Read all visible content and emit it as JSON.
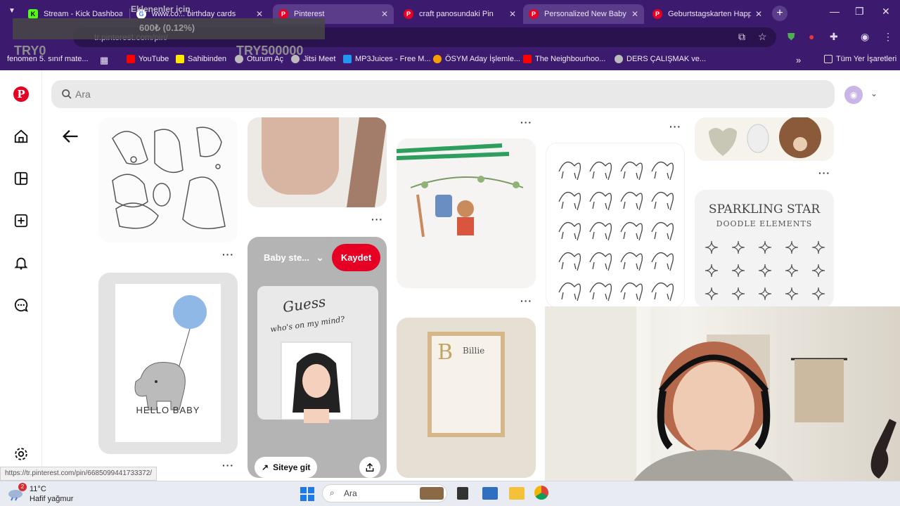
{
  "browser": {
    "tabs": [
      {
        "title": "Stream - Kick Dashboard",
        "favicon": "kick-icon",
        "color": "#53fc18",
        "closable": false
      },
      {
        "title": "www.co... birthday cards",
        "favicon": "google-icon",
        "color": "#4285f4",
        "closable": true
      },
      {
        "title": "Pinterest",
        "favicon": "pinterest-icon",
        "color": "#e60023",
        "closable": true
      },
      {
        "title": "craft panosundaki Pin",
        "favicon": "pinterest-icon",
        "color": "#e60023",
        "closable": true
      },
      {
        "title": "Personalized New Baby Ca",
        "favicon": "pinterest-icon",
        "color": "#e60023",
        "closable": true,
        "active": true
      },
      {
        "title": "Geburtstagskarten Happy",
        "favicon": "pinterest-icon",
        "color": "#e60023",
        "closable": true
      }
    ],
    "url": "tr.pinterest.com/pin/",
    "bookmarks": [
      {
        "label": "fenomen 5. sınıf mate..."
      },
      {
        "label": "YouTube"
      },
      {
        "label": "Sahibinden"
      },
      {
        "label": "Oturum Aç"
      },
      {
        "label": "Jitsi Meet"
      },
      {
        "label": "MP3Juices - Free M..."
      },
      {
        "label": "ÖSYM Aday İşlemle..."
      },
      {
        "label": "The Neighbourhoo..."
      },
      {
        "label": "DERS ÇALIŞMAK ve..."
      },
      {
        "label": "Tüm Yer İşaretleri"
      }
    ],
    "status_url": "https://tr.pinterest.com/pin/6685099441733372/"
  },
  "overlay": {
    "title": "Eklenenler için",
    "value": "600₺ (0.12%)",
    "left_amount": "TRY0",
    "right_amount": "TRY500000"
  },
  "pinterest": {
    "search_placeholder": "Ara",
    "pins": {
      "baby_steps_board": "Baby ste...",
      "save_label": "Kaydet",
      "visit_label": "Siteye git",
      "hello_baby_caption": "HELLO BABY",
      "guess_text_line1": "Guess",
      "guess_text_line2": "who's on my mind?",
      "sparkling_title": "SPARKLING STAR",
      "sparkling_subtitle": "DOODLE ELEMENTS",
      "frame_name": "Billie",
      "frame_letter": "B"
    }
  },
  "taskbar": {
    "temp": "11°C",
    "condition": "Hafif yağmur",
    "search_placeholder": "Ara",
    "notification_count": "2"
  }
}
